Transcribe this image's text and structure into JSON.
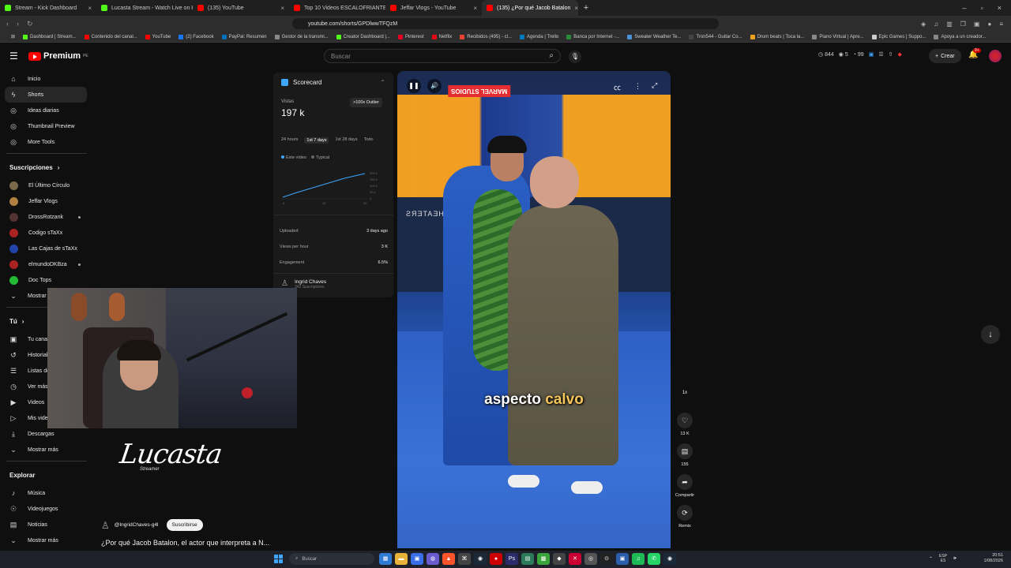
{
  "browser": {
    "tabs": [
      {
        "title": "Stream - Kick Dashboard",
        "color": "#53fc18"
      },
      {
        "title": "Lucasta Stream - Watch Live on Kick",
        "color": "#53fc18"
      },
      {
        "title": "(135) YouTube",
        "color": "#ff0000"
      },
      {
        "title": "Top 10 Videos ESCALOFRIANTES De",
        "color": "#ff0000"
      },
      {
        "title": "Jeffar Vlogs - YouTube",
        "color": "#ff0000"
      },
      {
        "title": "(135) ¿Por qué Jacob Batalon",
        "color": "#ff0000",
        "active": true
      }
    ],
    "url": "youtube.com/shorts/GPDlwwTFQzM",
    "bookmarks": [
      {
        "label": "Dashboard | Stream...",
        "color": "#53fc18"
      },
      {
        "label": "Contenido del canal...",
        "color": "#ff0000"
      },
      {
        "label": "YouTube",
        "color": "#ff0000"
      },
      {
        "label": "(2) Facebook",
        "color": "#1877f2"
      },
      {
        "label": "PayPal: Resumen",
        "color": "#0070ba"
      },
      {
        "label": "Gestor de la transmi...",
        "color": "#888888"
      },
      {
        "label": "Creator Dashboard |...",
        "color": "#53fc18"
      },
      {
        "label": "Pinterest",
        "color": "#e60023"
      },
      {
        "label": "Netflix",
        "color": "#e50914"
      },
      {
        "label": "Recibidos (495) - cl...",
        "color": "#ea4335"
      },
      {
        "label": "Agenda | Trello",
        "color": "#0079bf"
      },
      {
        "label": "Banca por Internet -...",
        "color": "#2a8c3a"
      },
      {
        "label": "Sweater Weather Te...",
        "color": "#4a90d9"
      },
      {
        "label": "Tron544 - Guitar Co...",
        "color": "#444444"
      },
      {
        "label": "Drum beats | Toca la...",
        "color": "#f0a021"
      },
      {
        "label": "Piano Virtual | Apre...",
        "color": "#888888"
      },
      {
        "label": "Epic Games | Suppo...",
        "color": "#cccccc"
      },
      {
        "label": "Apoya a un creador...",
        "color": "#888888"
      }
    ]
  },
  "header": {
    "brand": "Premium",
    "region": "PE",
    "search_placeholder": "Buscar",
    "stats": [
      "844",
      "5",
      "99"
    ],
    "create_label": "Crear",
    "notif_badge": "9+"
  },
  "sidebar": {
    "main": [
      {
        "label": "Inicio",
        "icon": "home-icon"
      },
      {
        "label": "Shorts",
        "icon": "shorts-icon",
        "active": true
      },
      {
        "label": "Ideas diarias",
        "icon": "ideas-icon"
      },
      {
        "label": "Thumbnail Preview",
        "icon": "thumbnail-icon"
      },
      {
        "label": "More Tools",
        "icon": "tools-icon"
      }
    ],
    "subs_title": "Suscripciones",
    "subs": [
      {
        "label": "El Último Círculo",
        "color": "#7a6a4a"
      },
      {
        "label": "Jeffar Vlogs",
        "color": "#b08040"
      },
      {
        "label": "DrossRotzank",
        "color": "#553333",
        "live": true
      },
      {
        "label": "Codigo sTaXx",
        "color": "#aa2222"
      },
      {
        "label": "Las Cajas de sTaXx",
        "color": "#2244aa"
      },
      {
        "label": "elmundoDKBza",
        "color": "#aa2222",
        "live": true
      },
      {
        "label": "Doc Tops",
        "color": "#22bb33"
      }
    ],
    "show_more": "Mostrar más",
    "you_title": "Tú",
    "you": [
      {
        "label": "Tu canal",
        "icon": "channel-icon"
      },
      {
        "label": "Historial",
        "icon": "history-icon"
      },
      {
        "label": "Listas de reproducción",
        "icon": "playlist-icon"
      },
      {
        "label": "Ver más tarde",
        "icon": "clock-icon"
      },
      {
        "label": "Videos",
        "icon": "video-icon"
      },
      {
        "label": "Mis videos",
        "icon": "myvideos-icon"
      },
      {
        "label": "Descargas",
        "icon": "download-icon"
      },
      {
        "label": "Mostrar más",
        "icon": "chevron-down-icon"
      }
    ],
    "explore_title": "Explorar",
    "explore": [
      {
        "label": "Música",
        "icon": "music-icon"
      },
      {
        "label": "Videojuegos",
        "icon": "gamepad-icon"
      },
      {
        "label": "Noticias",
        "icon": "news-icon"
      },
      {
        "label": "Mostrar más",
        "icon": "chevron-down-icon"
      }
    ]
  },
  "scorecard": {
    "title": "Scorecard",
    "views_label": "Vistas",
    "views_value": "197 k",
    "outlier": ">100x Outlier",
    "periods": [
      "24 hours",
      "1st 7 days",
      "1st 28 days",
      "Todo"
    ],
    "active_period": "1st 7 days",
    "legend": [
      "Este vídeo",
      "Typical"
    ],
    "y_ticks": [
      "200 k",
      "150 k",
      "100 k",
      "50 k",
      "0"
    ],
    "x_ticks": [
      "0",
      "10",
      "20"
    ],
    "rows": [
      {
        "label": "Uploaded",
        "value": "3 days ago"
      },
      {
        "label": "Views per hour",
        "value": "3 K"
      },
      {
        "label": "Engagement",
        "value": "6.5%"
      }
    ],
    "author_name": "Ingrid Chaves",
    "author_subs": "342 Suscriptores"
  },
  "stream": {
    "overlay_name": "Lucasta",
    "overlay_sub": "Streamer"
  },
  "video": {
    "caption_white": "aspecto",
    "caption_yellow": "calvo",
    "theaters_text": "THEATERS",
    "marvel_text": "MARVEL STUDIOS",
    "channel_handle": "@IngridChaves-g4l",
    "subscribe_label": "Suscribirse",
    "title": "¿Por qué Jacob Batalon, el actor que interpreta a N..."
  },
  "rail": {
    "speed": "1x",
    "likes": "13 K",
    "comments": "155",
    "share": "Compartir",
    "remix": "Remix"
  },
  "taskbar": {
    "search": "Buscar",
    "lang_top": "ESP",
    "lang_bottom": "ES",
    "time": "20:51",
    "date": "1/08/2026"
  }
}
